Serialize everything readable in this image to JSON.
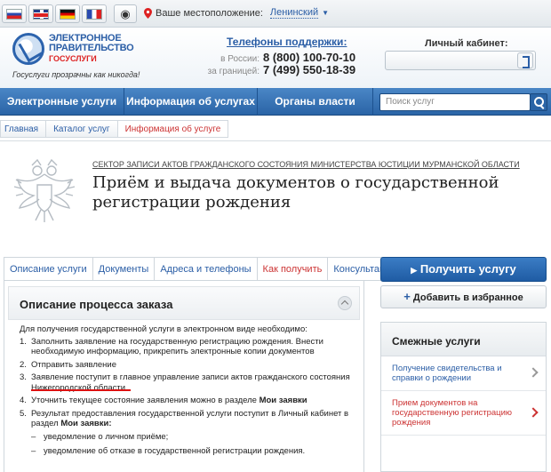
{
  "topbar": {
    "languages": [
      "ru",
      "en",
      "de",
      "fr"
    ],
    "accessibility_icon": "eye-icon",
    "location_label": "Ваше местоположение:",
    "location_city": "Ленинский"
  },
  "header": {
    "logo_line1": "ЭЛЕКТРОННОЕ",
    "logo_line2": "ПРАВИТЕЛЬСТВО",
    "logo_line3": "ГОСУСЛУГИ",
    "slogan": "Госуслуги прозрачны как никогда!",
    "phones_title": "Телефоны поддержки:",
    "phone_ru_label": "в России:",
    "phone_ru": "8 (800) 100-70-10",
    "phone_abroad_label": "за границей:",
    "phone_abroad": "7 (499) 550-18-39",
    "cabinet_title": "Личный кабинет:"
  },
  "nav": {
    "items": [
      "Электронные услуги",
      "Информация об услугах",
      "Органы власти"
    ],
    "search_placeholder": "Поиск услуг"
  },
  "breadcrumbs": [
    "Главная",
    "Каталог услуг",
    "Информация об услуге"
  ],
  "service": {
    "department": "СЕКТОР ЗАПИСИ АКТОВ ГРАЖДАНСКОГО СОСТОЯНИЯ МИНИСТЕРСТВА ЮСТИЦИИ МУРМАНСКОЙ ОБЛАСТИ",
    "title": "Приём и выдача документов о государственной регистрации рождения"
  },
  "tabs": [
    "Описание услуги",
    "Документы",
    "Адреса и телефоны",
    "Как получить",
    "Консультация"
  ],
  "active_tab": "Как получить",
  "panel": {
    "title": "Описание процесса заказа",
    "intro": "Для получения государственной услуги в электронном виде необходимо:",
    "steps": [
      "Заполнить заявление на государственную регистрацию рождения. Внести необходимую информацию, прикрепить электронные копии документов",
      "Отправить заявление",
      "Заявление поступит в главное управление записи актов гражданского состояния Нижегородской области",
      "Уточнить текущее состояние заявления можно в разделе ",
      "Результат предоставления государственной услуги поступит в Личный кабинет в раздел "
    ],
    "step4_bold": "Мои заявки",
    "step5_bold": "Мои заявки",
    "step5_tail": ":",
    "sub_items": [
      "уведомление о личном приёме;",
      "уведомление об отказе в государственной регистрации рождения."
    ]
  },
  "sidebar": {
    "get_service": "Получить услугу",
    "add_favorite": "Добавить в избранное",
    "related_title": "Смежные услуги",
    "related": [
      "Получение свидетельства и справки о рождении",
      "Прием документов на государственную регистрацию рождения"
    ]
  },
  "colors": {
    "brand_blue": "#2b5ea6",
    "nav_blue": "#2a64a6",
    "accent_red": "#cc3333",
    "annotation_red": "#dd1111"
  }
}
